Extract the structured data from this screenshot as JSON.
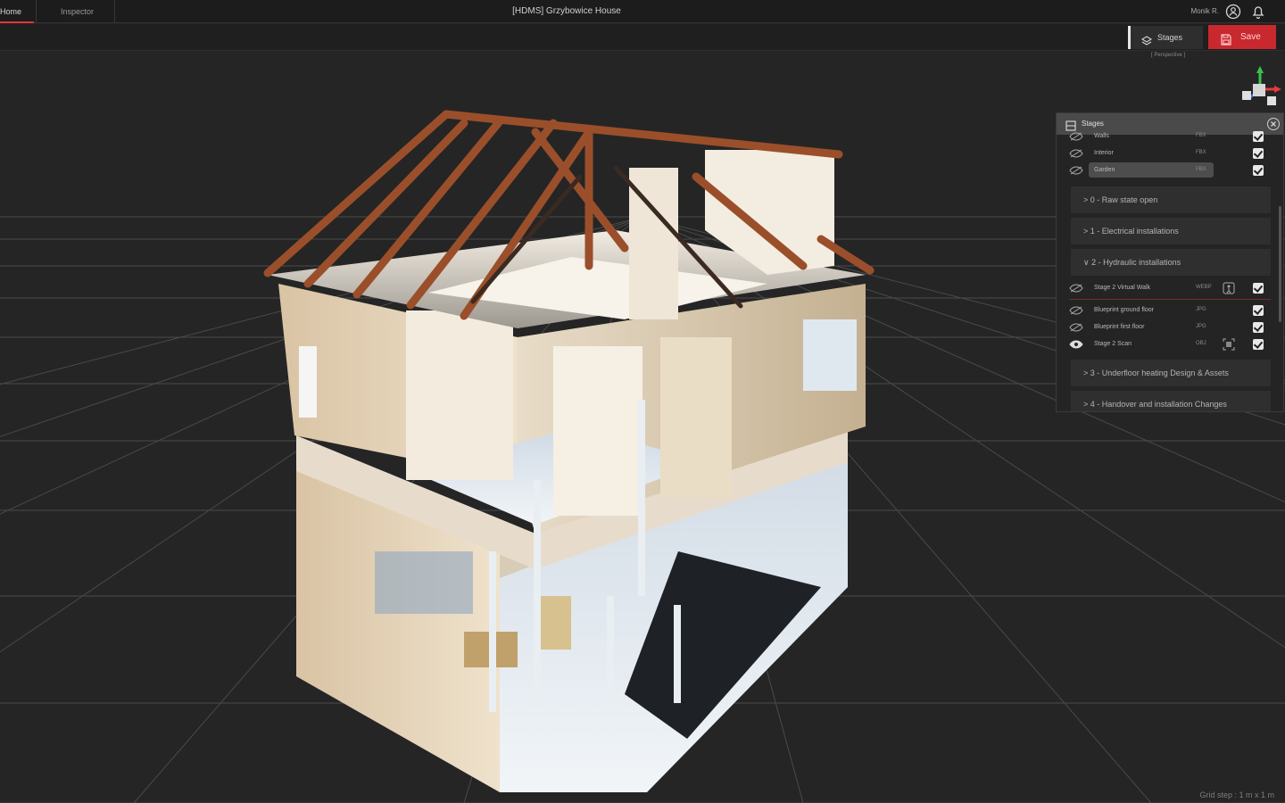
{
  "header": {
    "tabs": [
      {
        "label": "Home",
        "active": true
      },
      {
        "label": "Inspector",
        "active": false
      }
    ],
    "title": "[HDMS] Grzybowice House",
    "user": "Monik R.",
    "icons": [
      "account-icon",
      "bell-icon"
    ]
  },
  "toolbar": {
    "stages_label": "Stages",
    "save_label": "Save",
    "view_mode": "[ Perspective ]"
  },
  "viewport": {
    "grid_status": "Grid step : 1 m x 1 m",
    "model": "point-cloud-house-cutaway"
  },
  "stages_panel": {
    "title": "Stages",
    "top_rows": [
      {
        "label": "Walls",
        "ext": "FBX",
        "checked": true,
        "highlighted": false
      },
      {
        "label": "Interior",
        "ext": "FBX",
        "checked": true,
        "highlighted": false
      },
      {
        "label": "Garden",
        "ext": "FBX",
        "checked": true,
        "highlighted": true
      }
    ],
    "sections_a": [
      "> 0 - Raw state open",
      "> 1 - Electrical installations",
      "∨ 2 - Hydraulic installations"
    ],
    "stage_rows": [
      {
        "label": "Stage 2 Virtual Walk",
        "ext": "WEBP",
        "checked": true
      },
      {
        "label": "Blueprint ground floor",
        "ext": "JPG",
        "checked": true
      },
      {
        "label": "Blueprint first floor",
        "ext": "JPG",
        "checked": true
      },
      {
        "label": "Stage 2 Scan",
        "ext": "OBJ",
        "checked": true
      }
    ],
    "sections_b": [
      "> 3 - Underfloor heating Design & Assets",
      "> 4 - Handover and installation Changes"
    ]
  },
  "colors": {
    "accent": "#c8282e",
    "background": "#252525",
    "panel": "#242424"
  }
}
